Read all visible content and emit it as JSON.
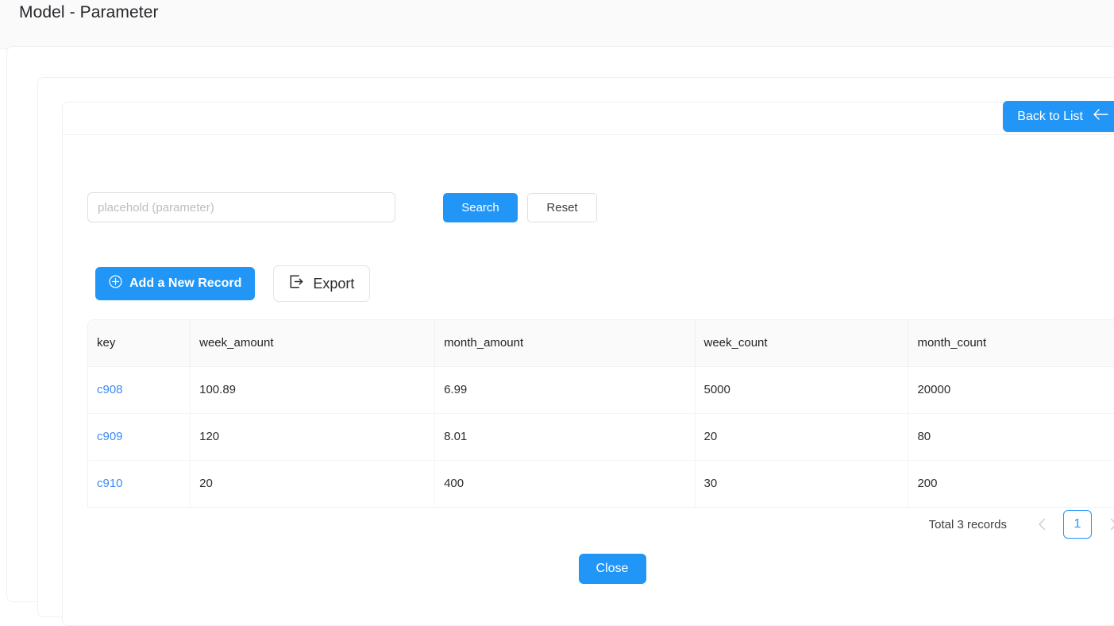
{
  "titlebar": {
    "title": "Model - Parameter"
  },
  "header": {
    "back_label": "Back to List",
    "back_icon": "arrow-left-icon"
  },
  "search": {
    "placeholder": "placehold (parameter)",
    "value": "",
    "search_label": "Search",
    "reset_label": "Reset"
  },
  "actions": {
    "add_label": "Add a New Record",
    "add_icon": "plus-circle-icon",
    "export_label": "Export",
    "export_icon": "export-icon"
  },
  "table": {
    "columns": [
      "key",
      "week_amount",
      "month_amount",
      "week_count",
      "month_count"
    ],
    "rows": [
      {
        "key": "c908",
        "week_amount": "100.89",
        "month_amount": "6.99",
        "week_count": "5000",
        "month_count": "20000"
      },
      {
        "key": "c909",
        "week_amount": "120",
        "month_amount": "8.01",
        "week_count": "20",
        "month_count": "80"
      },
      {
        "key": "c910",
        "week_amount": "20",
        "month_amount": "400",
        "week_count": "30",
        "month_count": "200"
      }
    ]
  },
  "pagination": {
    "total_label": "Total 3 records",
    "prev_icon": "chevron-left-icon",
    "next_icon": "chevron-right-icon",
    "current_page": "1"
  },
  "footer": {
    "close_label": "Close"
  },
  "colors": {
    "primary": "#2196f7",
    "link": "#3d8bf5",
    "border": "#f0f0f0",
    "titlebar_bg": "#fafafa",
    "header_bg": "#fafafa"
  }
}
